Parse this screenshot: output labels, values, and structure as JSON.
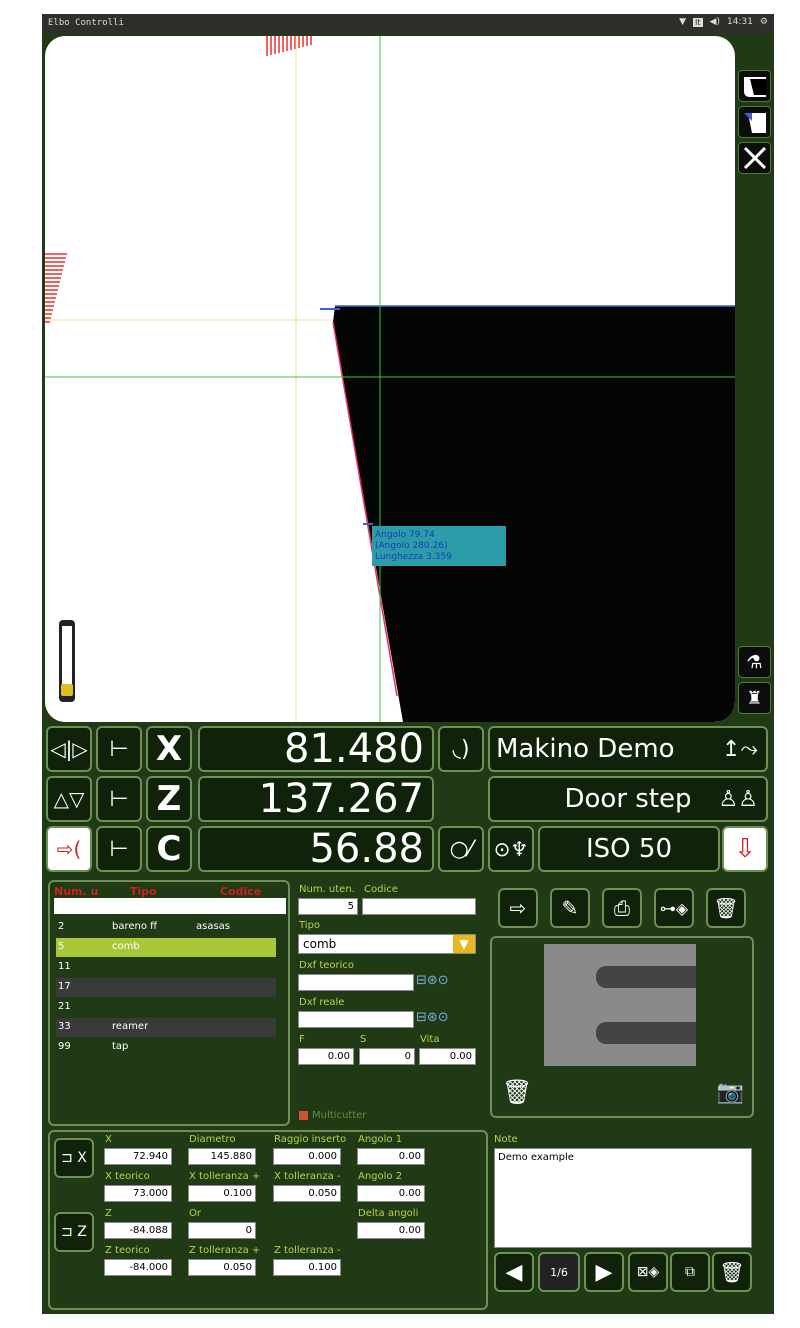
{
  "window": {
    "title": "Elbo Controlli",
    "clock": "14:31"
  },
  "measure_label": {
    "angle": "Angolo 79.74",
    "angle2": "(Angolo 280.26)",
    "length": "Lunghezza 3.359"
  },
  "axes": {
    "x": {
      "letter": "X",
      "value": "81.480"
    },
    "z": {
      "letter": "Z",
      "value": "137.267"
    },
    "c": {
      "letter": "C",
      "value": "56.88"
    }
  },
  "info": {
    "machine": "Makino Demo",
    "profile": "Door step",
    "standard": "ISO 50"
  },
  "tool_table": {
    "headers": [
      "Num. u",
      "Tipo",
      "Codice"
    ],
    "rows": [
      {
        "num": "2",
        "tipo": "bareno ff",
        "codice": "asasas"
      },
      {
        "num": "5",
        "tipo": "comb",
        "codice": ""
      },
      {
        "num": "11",
        "tipo": "",
        "codice": ""
      },
      {
        "num": "17",
        "tipo": "",
        "codice": ""
      },
      {
        "num": "21",
        "tipo": "",
        "codice": ""
      },
      {
        "num": "33",
        "tipo": "reamer",
        "codice": ""
      },
      {
        "num": "99",
        "tipo": "tap",
        "codice": ""
      }
    ]
  },
  "tool_form": {
    "num_label": "Num. uten.",
    "num_value": "5",
    "codice_label": "Codice",
    "codice_value": "",
    "tipo_label": "Tipo",
    "tipo_value": "comb",
    "dxf_teorico_label": "Dxf teorico",
    "dxf_reale_label": "Dxf reale",
    "f_label": "F",
    "f_value": "0.00",
    "s_label": "S",
    "s_value": "0",
    "vita_label": "Vita",
    "vita_value": "0.00",
    "multicutter_label": "Multicutter"
  },
  "params": {
    "x_label": "X",
    "x_value": "72.940",
    "diametro_label": "Diametro",
    "diametro_value": "145.880",
    "raggio_label": "Raggio inserto",
    "raggio_value": "0.000",
    "angolo1_label": "Angolo 1",
    "angolo1_value": "0.00",
    "xteorico_label": "X teorico",
    "xteorico_value": "73.000",
    "xtolp_label": "X tolleranza +",
    "xtolp_value": "0.100",
    "xtolm_label": "X tolleranza -",
    "xtolm_value": "0.050",
    "angolo2_label": "Angolo 2",
    "angolo2_value": "0.00",
    "z_label": "Z",
    "z_value": "-84.088",
    "or_label": "Or",
    "or_value": "0",
    "delta_label": "Delta angoli",
    "delta_value": "0.00",
    "zteorico_label": "Z teorico",
    "zteorico_value": "-84.000",
    "ztolp_label": "Z tolleranza +",
    "ztolp_value": "0.050",
    "ztolm_label": "Z tolleranza -",
    "ztolm_value": "0.100"
  },
  "notes": {
    "label": "Note",
    "text": "Demo example"
  },
  "pager": {
    "text": "1/6"
  }
}
